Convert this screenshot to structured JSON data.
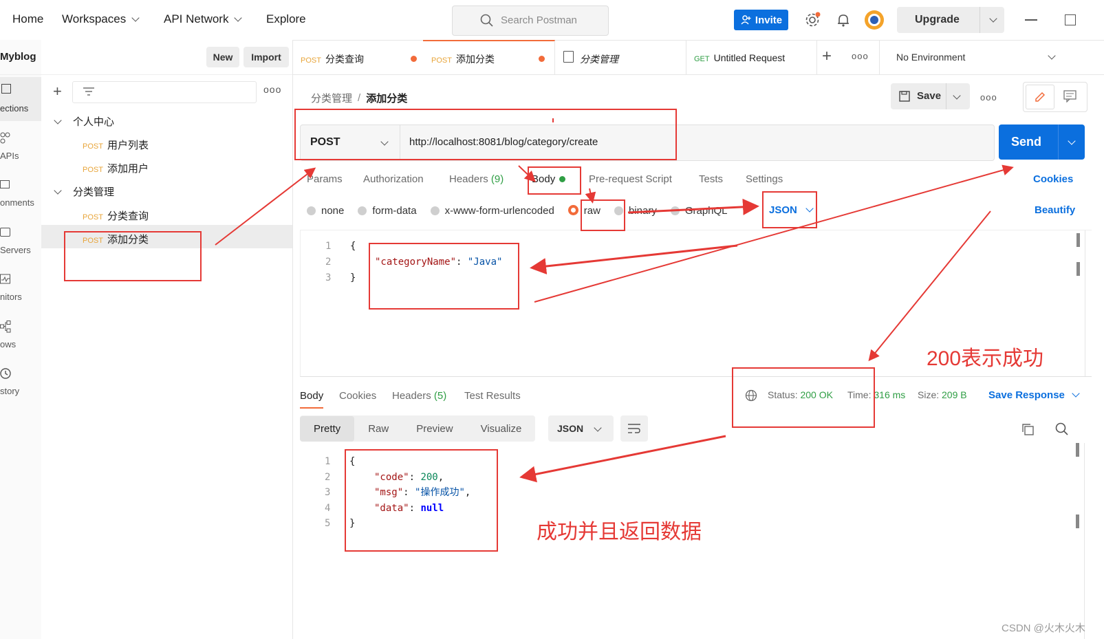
{
  "topbar": {
    "home": "Home",
    "workspaces": "Workspaces",
    "api_network": "API Network",
    "explore": "Explore",
    "search_placeholder": "Search Postman",
    "invite": "Invite",
    "upgrade": "Upgrade"
  },
  "sidebar": {
    "workspace_name": "Myblog",
    "new_label": "New",
    "import_label": "Import",
    "rail": [
      {
        "label": "ections",
        "icon": "collections-icon"
      },
      {
        "label": "APIs",
        "icon": "apis-icon"
      },
      {
        "label": "onments",
        "icon": "environments-icon"
      },
      {
        "label": "Servers",
        "icon": "servers-icon"
      },
      {
        "label": "nitors",
        "icon": "monitors-icon"
      },
      {
        "label": "ows",
        "icon": "flows-icon"
      },
      {
        "label": "story",
        "icon": "history-icon"
      }
    ],
    "tree": {
      "folder1": "个人中心",
      "req1_method": "POST",
      "req1": "用户列表",
      "req2_method": "POST",
      "req2": "添加用户",
      "folder2": "分类管理",
      "req3_method": "POST",
      "req3": "分类查询",
      "req4_method": "POST",
      "req4": "添加分类"
    }
  },
  "tabs": [
    {
      "method": "POST",
      "label": "分类查询"
    },
    {
      "method": "POST",
      "label": "添加分类"
    },
    {
      "method": "",
      "label": "分类管理"
    },
    {
      "method": "GET",
      "label": "Untitled Request"
    }
  ],
  "environment": "No Environment",
  "breadcrumb": {
    "parent": "分类管理",
    "sep": "/",
    "current": "添加分类"
  },
  "save_label": "Save",
  "request": {
    "method": "POST",
    "url": "http://localhost:8081/blog/category/create",
    "send": "Send",
    "subtabs": {
      "params": "Params",
      "authorization": "Authorization",
      "headers": "Headers",
      "headers_count": "(9)",
      "body": "Body",
      "prerequest": "Pre-request Script",
      "tests": "Tests",
      "settings": "Settings",
      "cookies": "Cookies"
    },
    "body_types": {
      "none": "none",
      "form_data": "form-data",
      "urlencoded": "x-www-form-urlencoded",
      "raw": "raw",
      "binary": "binary",
      "graphql": "GraphQL",
      "format": "JSON",
      "beautify": "Beautify"
    },
    "body_lines": {
      "l1": "1",
      "l2": "2",
      "l3": "3",
      "open": "{",
      "key": "\"categoryName\"",
      "colon": ": ",
      "value": "\"Java\"",
      "close": "}"
    }
  },
  "response": {
    "tabs": {
      "body": "Body",
      "cookies": "Cookies",
      "headers": "Headers",
      "headers_count": "(5)",
      "test_results": "Test Results"
    },
    "status_label": "Status:",
    "status_value": "200 OK",
    "time_label": "Time:",
    "time_value": "316 ms",
    "size_label": "Size:",
    "size_value": "209 B",
    "save_response": "Save Response",
    "views": {
      "pretty": "Pretty",
      "raw": "Raw",
      "preview": "Preview",
      "visualize": "Visualize",
      "format": "JSON"
    },
    "lines": {
      "l1": "1",
      "l2": "2",
      "l3": "3",
      "l4": "4",
      "l5": "5",
      "open": "{",
      "code_key": "\"code\"",
      "code_val": "200",
      "msg_key": "\"msg\"",
      "msg_val": "\"操作成功\"",
      "data_key": "\"data\"",
      "data_val": "null",
      "close": "}"
    }
  },
  "annotations": {
    "status_note": "200表示成功",
    "response_note": "成功并且返回数据",
    "watermark": "CSDN @火木火木"
  },
  "colors": {
    "accent": "#0b6fde",
    "post": "#e8a53a",
    "annotation": "#e53935",
    "success": "#2f9e44"
  }
}
